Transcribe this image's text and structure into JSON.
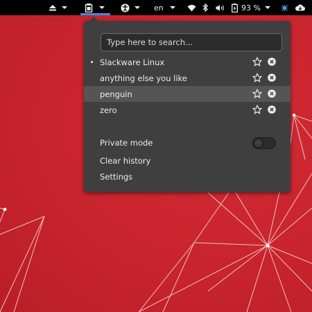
{
  "topbar": {
    "language": "en",
    "battery_percent": "93 %",
    "icons": [
      "eject-icon",
      "clipboard-icon",
      "accessibility-icon",
      "wifi-icon",
      "bluetooth-icon",
      "volume-icon",
      "battery-icon",
      "network-app-icon",
      "shutdown-icon"
    ]
  },
  "popup": {
    "search": {
      "placeholder": "Type here to search..."
    },
    "items": [
      {
        "label": "Slackware Linux",
        "current": true
      },
      {
        "label": "anything else you like",
        "current": false
      },
      {
        "label": "penguin",
        "current": false
      },
      {
        "label": "zero",
        "current": false
      }
    ],
    "private_mode_label": "Private mode",
    "private_mode_on": false,
    "clear_history_label": "Clear history",
    "settings_label": "Settings"
  },
  "colors": {
    "accent": "#3a8ee6",
    "wallpaper": "#c8242d",
    "popup_bg": "#3f3f3f"
  }
}
